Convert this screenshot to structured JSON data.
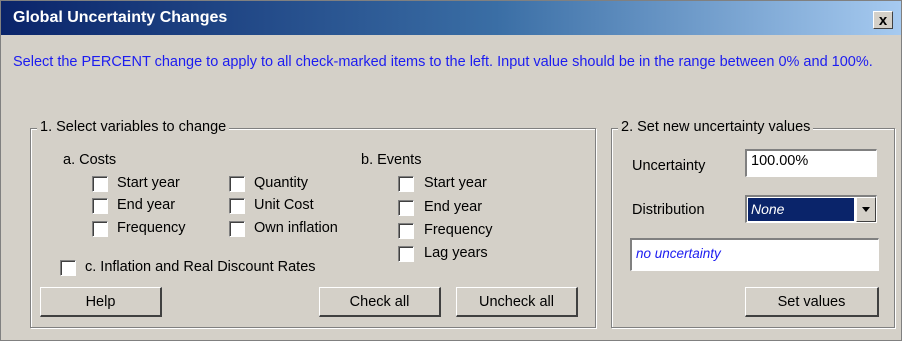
{
  "window": {
    "title": "Global Uncertainty Changes",
    "close_glyph": "x"
  },
  "instruction": "Select the PERCENT change to apply to all check-marked items to the left. Input value should be in the range  between 0% and 100%.",
  "group1": {
    "legend": "1. Select variables to change",
    "costs": {
      "heading": "a. Costs",
      "col1": [
        "Start year",
        "End year",
        "Frequency"
      ],
      "col2": [
        "Quantity",
        "Unit Cost",
        "Own inflation"
      ]
    },
    "events": {
      "heading": "b. Events",
      "items": [
        "Start year",
        "End year",
        "Frequency",
        "Lag years"
      ]
    },
    "inflation_label": "c. Inflation and Real Discount Rates",
    "help_label": "Help",
    "check_all_label": "Check all",
    "uncheck_all_label": "Uncheck all"
  },
  "group2": {
    "legend": "2. Set new uncertainty values",
    "uncertainty_label": "Uncertainty",
    "uncertainty_value": "100.00%",
    "distribution_label": "Distribution",
    "distribution_value": "None",
    "description": "no uncertainty",
    "set_values_label": "Set values"
  },
  "colors": {
    "instruction_text": "#1c1cf0",
    "titlebar": "#0a246a",
    "window_bg": "#d4d0c8"
  }
}
